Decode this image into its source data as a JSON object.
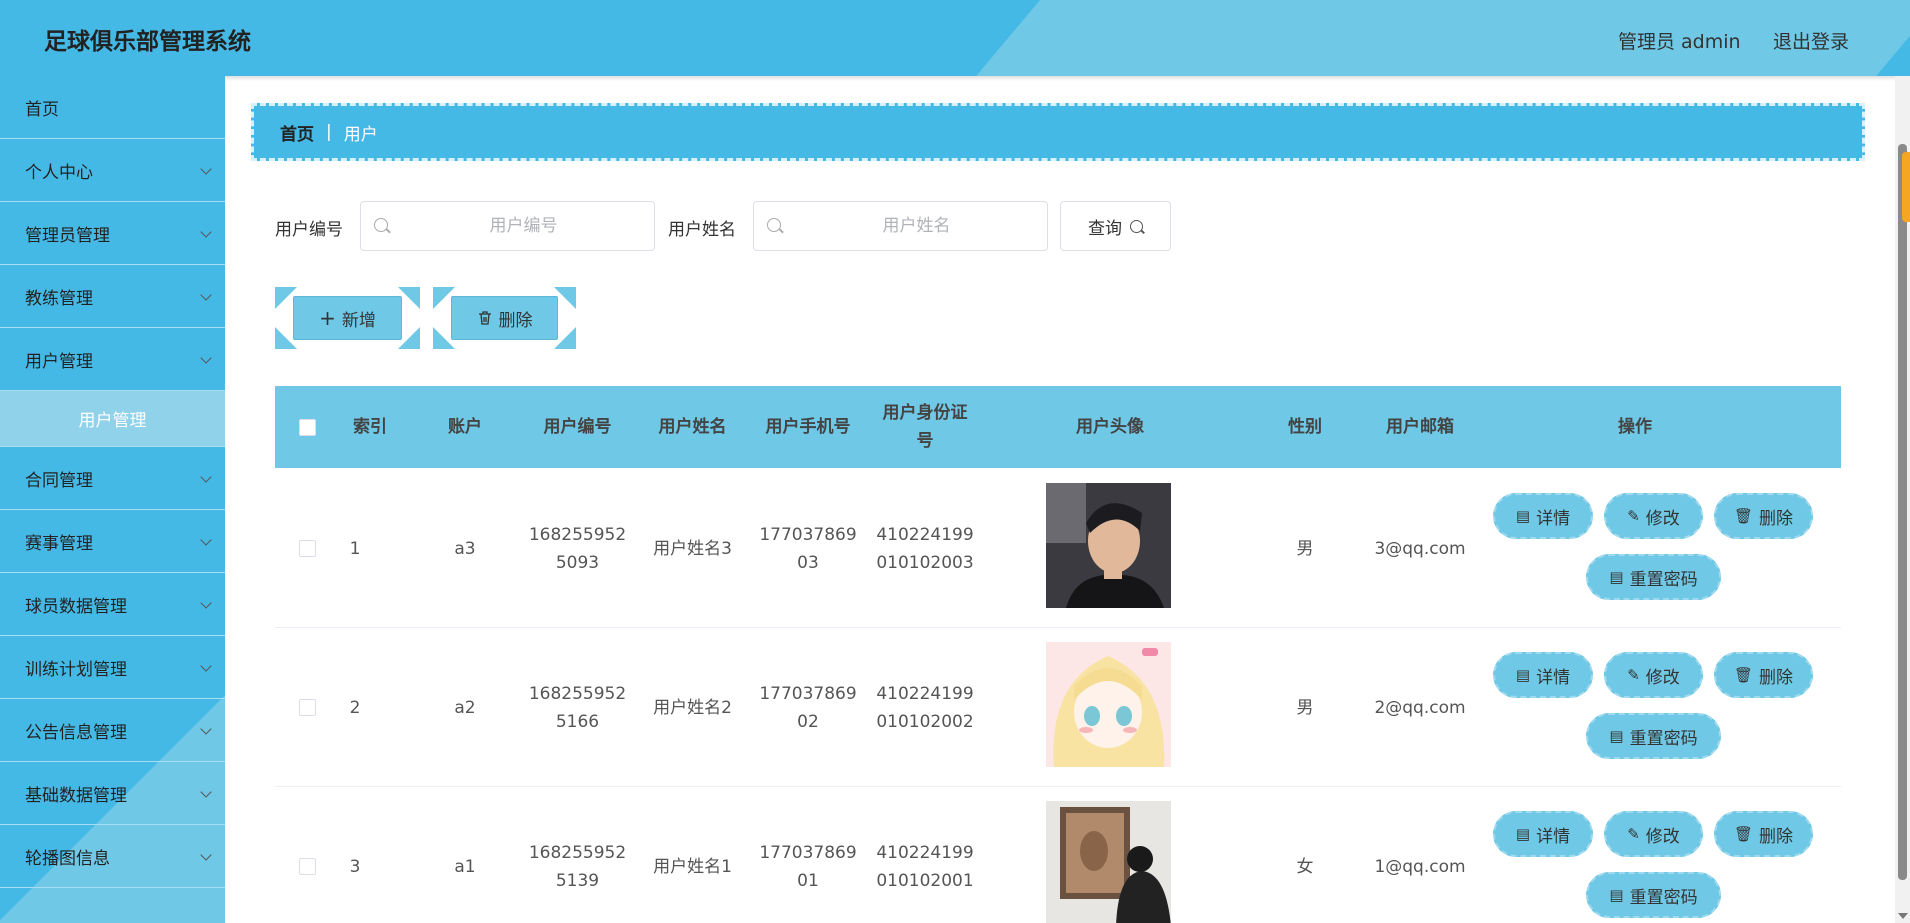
{
  "app": {
    "title": "足球俱乐部管理系统"
  },
  "header": {
    "admin_label": "管理员 admin",
    "logout_label": "退出登录"
  },
  "sidebar": {
    "items": [
      {
        "label": "首页",
        "has_arrow": false
      },
      {
        "label": "个人中心",
        "has_arrow": true
      },
      {
        "label": "管理员管理",
        "has_arrow": true
      },
      {
        "label": "教练管理",
        "has_arrow": true
      },
      {
        "label": "用户管理",
        "has_arrow": true,
        "expanded": true
      },
      {
        "label": "合同管理",
        "has_arrow": true
      },
      {
        "label": "赛事管理",
        "has_arrow": true
      },
      {
        "label": "球员数据管理",
        "has_arrow": true
      },
      {
        "label": "训练计划管理",
        "has_arrow": true
      },
      {
        "label": "公告信息管理",
        "has_arrow": true
      },
      {
        "label": "基础数据管理",
        "has_arrow": true
      },
      {
        "label": "轮播图信息",
        "has_arrow": true
      }
    ],
    "sub_item": "用户管理"
  },
  "breadcrumb": {
    "home": "首页",
    "separator": "|",
    "current": "用户"
  },
  "search": {
    "field1_label": "用户编号",
    "field1_placeholder": "用户编号",
    "field2_label": "用户姓名",
    "field2_placeholder": "用户姓名",
    "query_label": "查询"
  },
  "actions": {
    "add_label": "新增",
    "delete_label": "删除"
  },
  "table": {
    "headers": [
      "索引",
      "账户",
      "用户编号",
      "用户姓名",
      "用户手机号",
      "用户身份证号",
      "用户头像",
      "性别",
      "用户邮箱",
      "操作"
    ],
    "id_header_line1": "用户身份证",
    "id_header_line2": "号",
    "rows": [
      {
        "index": "1",
        "account": "a3",
        "code1": "168255952",
        "code2": "5093",
        "name": "用户姓名3",
        "phone1": "177037869",
        "phone2": "03",
        "idno1": "410224199",
        "idno2": "010102003",
        "gender": "男",
        "email": "3@qq.com"
      },
      {
        "index": "2",
        "account": "a2",
        "code1": "168255952",
        "code2": "5166",
        "name": "用户姓名2",
        "phone1": "177037869",
        "phone2": "02",
        "idno1": "410224199",
        "idno2": "010102002",
        "gender": "男",
        "email": "2@qq.com"
      },
      {
        "index": "3",
        "account": "a1",
        "code1": "168255952",
        "code2": "5139",
        "name": "用户姓名1",
        "phone1": "177037869",
        "phone2": "01",
        "idno1": "410224199",
        "idno2": "010102001",
        "gender": "女",
        "email": "1@qq.com"
      }
    ],
    "op_labels": {
      "detail": "详情",
      "edit": "修改",
      "delete": "删除",
      "reset": "重置密码"
    }
  },
  "colors": {
    "primary": "#45b9e6",
    "light": "#6fc8e6",
    "submenu": "#8fd2ea"
  },
  "icons": [
    "search-icon",
    "plus-icon",
    "trash-icon",
    "document-icon",
    "edit-icon",
    "chevron-down-icon"
  ]
}
